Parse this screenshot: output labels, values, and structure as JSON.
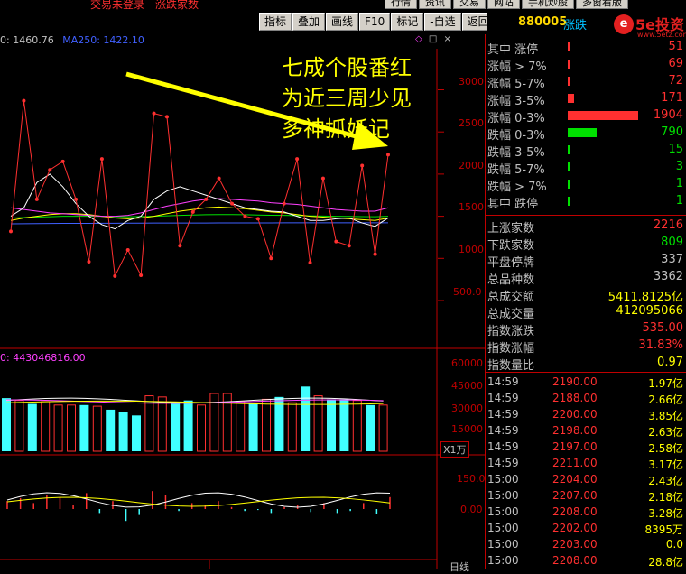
{
  "top_menu": {
    "left_text_1": "交易未登录",
    "left_text_2": "涨跌家数",
    "items": [
      "行情",
      "资讯",
      "交易",
      "网站",
      "手机炒股",
      "多窗看版"
    ]
  },
  "toolbar": {
    "buttons": [
      "指标",
      "叠加",
      "画线",
      "F10",
      "标记",
      "-自选",
      "返回"
    ]
  },
  "header": {
    "code": "880005",
    "name": "涨跌",
    "logo_mark": "e",
    "logo_text": "5e投资",
    "logo_url": "www.5etz.com"
  },
  "price_legend": {
    "ma_prefix": "0: 1460.76",
    "ma250": "MA250: 1422.10"
  },
  "vol_legend": {
    "value": "0: 443046816.00"
  },
  "annotation": {
    "line1": "七成个股番红",
    "line2": "为近三周少见",
    "line3": "多神抓妖记"
  },
  "price_axis": [
    "3000",
    "2500",
    "2000",
    "1500",
    "1000",
    "500.0"
  ],
  "vol_axis": [
    "60000",
    "45000",
    "30000",
    "15000"
  ],
  "vol_unit": "X1万",
  "macd_axis": [
    "150.0",
    "0.00"
  ],
  "bottom_label": "日线",
  "colors": {
    "red": "#ff3030",
    "green": "#00e000",
    "yellow": "#ffff00",
    "cyan": "#00ffff",
    "magenta": "#ff40ff",
    "white": "#ffffff"
  },
  "distribution": [
    {
      "label": "其中 涨停",
      "value": "51",
      "kind": "up",
      "fraction": 0.01
    },
    {
      "label": "涨幅 > 7%",
      "value": "69",
      "kind": "up",
      "fraction": 0.02
    },
    {
      "label": "涨幅 5-7%",
      "value": "72",
      "kind": "up",
      "fraction": 0.02
    },
    {
      "label": "涨幅 3-5%",
      "value": "171",
      "kind": "up",
      "fraction": 0.09
    },
    {
      "label": "涨幅 0-3%",
      "value": "1904",
      "kind": "up",
      "fraction": 1.0
    },
    {
      "label": "跌幅 0-3%",
      "value": "790",
      "kind": "down",
      "fraction": 0.41
    },
    {
      "label": "跌幅 3-5%",
      "value": "15",
      "kind": "down",
      "fraction": 0.01
    },
    {
      "label": "跌幅 5-7%",
      "value": "3",
      "kind": "down",
      "fraction": 0.005
    },
    {
      "label": "跌幅 > 7%",
      "value": "1",
      "kind": "down",
      "fraction": 0.005
    },
    {
      "label": "其中 跌停",
      "value": "1",
      "kind": "down",
      "fraction": 0.005
    }
  ],
  "stats": [
    {
      "label": "上涨家数",
      "value": "2216",
      "color": "#ff3030"
    },
    {
      "label": "下跌家数",
      "value": "809",
      "color": "#00e000"
    },
    {
      "label": "平盘停牌",
      "value": "337",
      "color": "#c0c0c0"
    },
    {
      "label": "总品种数",
      "value": "3362",
      "color": "#c0c0c0"
    },
    {
      "label": "总成交额",
      "value": "5411.8125亿",
      "color": "#ffff00"
    },
    {
      "label": "总成交量",
      "value": "412095066",
      "color": "#ffff00"
    },
    {
      "label": "指数涨跌",
      "value": "535.00",
      "color": "#ff3030"
    },
    {
      "label": "指数涨幅",
      "value": "31.83%",
      "color": "#ff3030"
    },
    {
      "label": "指数量比",
      "value": "0.97",
      "color": "#ffff00"
    }
  ],
  "ticks": [
    {
      "time": "14:59",
      "price": "2190.00",
      "vol": "1.97亿"
    },
    {
      "time": "14:59",
      "price": "2188.00",
      "vol": "2.66亿"
    },
    {
      "time": "14:59",
      "price": "2200.00",
      "vol": "3.85亿"
    },
    {
      "time": "14:59",
      "price": "2198.00",
      "vol": "2.63亿"
    },
    {
      "time": "14:59",
      "price": "2197.00",
      "vol": "2.58亿"
    },
    {
      "time": "14:59",
      "price": "2211.00",
      "vol": "3.17亿"
    },
    {
      "time": "15:00",
      "price": "2204.00",
      "vol": "2.43亿"
    },
    {
      "time": "15:00",
      "price": "2207.00",
      "vol": "2.18亿"
    },
    {
      "time": "15:00",
      "price": "2208.00",
      "vol": "3.28亿"
    },
    {
      "time": "15:00",
      "price": "2202.00",
      "vol": "8395万"
    },
    {
      "time": "15:00",
      "price": "2203.00",
      "vol": "0.0"
    },
    {
      "time": "15:00",
      "price": "2208.00",
      "vol": "28.8亿"
    }
  ],
  "price_series": [
    1320,
    2870,
    1700,
    2050,
    2150,
    1700,
    960,
    2180,
    790,
    1100,
    800,
    2720,
    2680,
    1150,
    1550,
    1700,
    1950,
    1650,
    1500,
    1470,
    1000,
    1650,
    2180,
    950,
    1950,
    1200,
    1150,
    2100,
    1050,
    2230
  ],
  "ma_white": [
    1500,
    1600,
    1900,
    2000,
    1850,
    1650,
    1500,
    1400,
    1350,
    1450,
    1500,
    1700,
    1800,
    1850,
    1800,
    1750,
    1700,
    1650,
    1600,
    1580,
    1560,
    1550,
    1500,
    1450,
    1450,
    1470,
    1480,
    1420,
    1380,
    1480
  ],
  "ma_magenta": [
    1600,
    1580,
    1560,
    1540,
    1530,
    1520,
    1510,
    1500,
    1500,
    1510,
    1540,
    1580,
    1620,
    1650,
    1680,
    1700,
    1710,
    1700,
    1690,
    1680,
    1660,
    1650,
    1640,
    1620,
    1600,
    1580,
    1570,
    1560,
    1560,
    1600
  ],
  "ma_yellow": [
    1450,
    1480,
    1500,
    1520,
    1530,
    1530,
    1520,
    1500,
    1480,
    1470,
    1480,
    1500,
    1530,
    1560,
    1580,
    1600,
    1610,
    1600,
    1590,
    1570,
    1550,
    1540,
    1520,
    1500,
    1490,
    1480,
    1470,
    1460,
    1450,
    1480
  ],
  "ma_green": [
    1480,
    1485,
    1490,
    1495,
    1500,
    1500,
    1500,
    1498,
    1495,
    1495,
    1497,
    1500,
    1505,
    1510,
    1515,
    1518,
    1520,
    1520,
    1518,
    1515,
    1512,
    1510,
    1508,
    1505,
    1503,
    1500,
    1498,
    1496,
    1495,
    1500
  ],
  "ma_blue": [
    1410,
    1412,
    1413,
    1414,
    1415,
    1416,
    1416,
    1417,
    1417,
    1418,
    1418,
    1419,
    1419,
    1420,
    1420,
    1420,
    1421,
    1421,
    1421,
    1421,
    1421,
    1422,
    1422,
    1422,
    1422,
    1422,
    1422,
    1422,
    1422,
    1422
  ],
  "volumes": [
    {
      "v": 46000,
      "c": "cyan"
    },
    {
      "v": 44000,
      "c": "red"
    },
    {
      "v": 41000,
      "c": "cyan"
    },
    {
      "v": 43000,
      "c": "red"
    },
    {
      "v": 40000,
      "c": "red"
    },
    {
      "v": 40000,
      "c": "red"
    },
    {
      "v": 40000,
      "c": "cyan"
    },
    {
      "v": 39000,
      "c": "red"
    },
    {
      "v": 36000,
      "c": "cyan"
    },
    {
      "v": 34000,
      "c": "cyan"
    },
    {
      "v": 31000,
      "c": "cyan"
    },
    {
      "v": 48000,
      "c": "red"
    },
    {
      "v": 47000,
      "c": "red"
    },
    {
      "v": 42000,
      "c": "cyan"
    },
    {
      "v": 44000,
      "c": "cyan"
    },
    {
      "v": 40000,
      "c": "red"
    },
    {
      "v": 50000,
      "c": "red"
    },
    {
      "v": 50000,
      "c": "red"
    },
    {
      "v": 43000,
      "c": "red"
    },
    {
      "v": 42000,
      "c": "cyan"
    },
    {
      "v": 45000,
      "c": "red"
    },
    {
      "v": 47000,
      "c": "cyan"
    },
    {
      "v": 42000,
      "c": "red"
    },
    {
      "v": 56000,
      "c": "cyan"
    },
    {
      "v": 48000,
      "c": "red"
    },
    {
      "v": 45000,
      "c": "cyan"
    },
    {
      "v": 45000,
      "c": "cyan"
    },
    {
      "v": 44000,
      "c": "red"
    },
    {
      "v": 40000,
      "c": "cyan"
    },
    {
      "v": 40000,
      "c": "red"
    }
  ],
  "macd": [
    40,
    55,
    30,
    70,
    60,
    20,
    80,
    -20,
    40,
    -60,
    -30,
    90,
    70,
    -10,
    30,
    20,
    40,
    10,
    -10,
    -5,
    -20,
    10,
    20,
    -15,
    30,
    -20,
    -10,
    30,
    -25,
    60
  ]
}
